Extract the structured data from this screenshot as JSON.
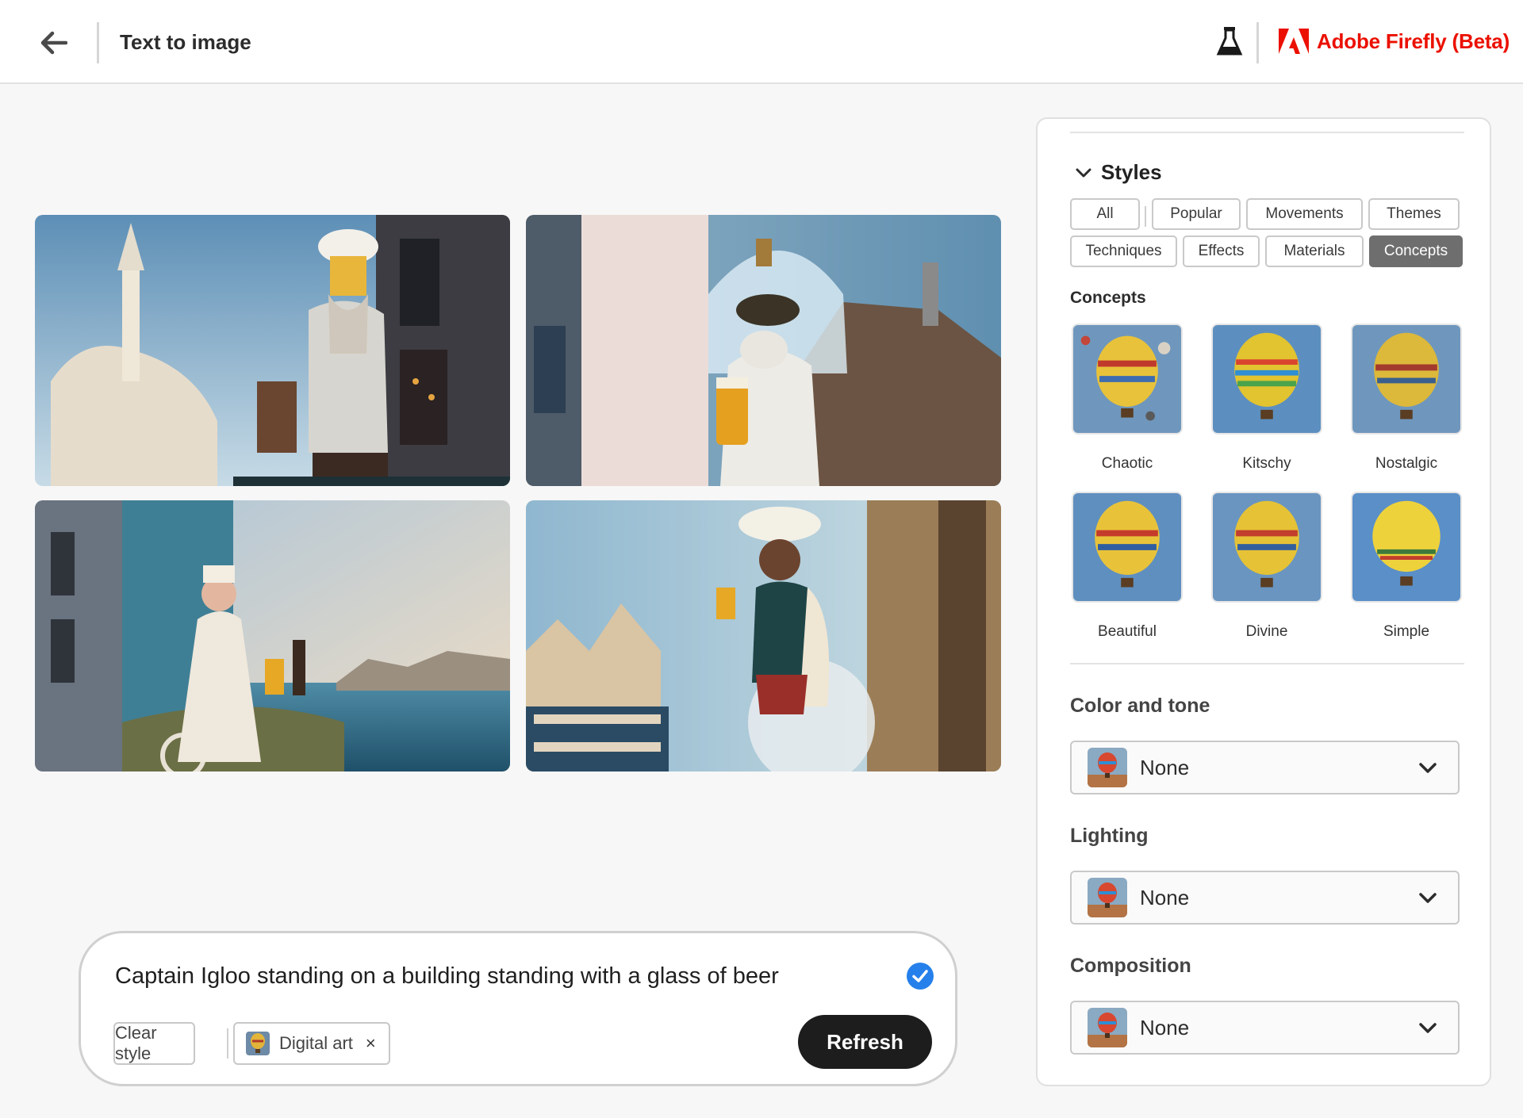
{
  "header": {
    "title": "Text to image",
    "brand": "Adobe Firefly (Beta)",
    "icons": {
      "back": "arrow-left-icon",
      "labs": "flask-icon",
      "brand": "adobe-logo-icon"
    },
    "brand_color": "#eb1000"
  },
  "gallery": {
    "images": [
      {
        "description_icon": "generated-image-icon"
      },
      {
        "description_icon": "generated-image-icon"
      },
      {
        "description_icon": "generated-image-icon"
      },
      {
        "description_icon": "generated-image-icon"
      }
    ]
  },
  "prompt": {
    "text": "Captain Igloo standing on a building standing with a glass of beer",
    "clear_style": "Clear style",
    "style_chip": "Digital art",
    "style_chip_remove": "×",
    "refresh": "Refresh",
    "accent_color": "#2680eb"
  },
  "panel": {
    "styles_title": "Styles",
    "tabs": [
      "All",
      "Popular",
      "Movements",
      "Themes",
      "Techniques",
      "Effects",
      "Materials",
      "Concepts"
    ],
    "active_tab": "Concepts",
    "concepts_label": "Concepts",
    "concepts": [
      "Chaotic",
      "Kitschy",
      "Nostalgic",
      "Beautiful",
      "Divine",
      "Simple"
    ],
    "color_and_tone": {
      "label": "Color and tone",
      "value": "None"
    },
    "lighting": {
      "label": "Lighting",
      "value": "None"
    },
    "composition": {
      "label": "Composition",
      "value": "None"
    }
  }
}
